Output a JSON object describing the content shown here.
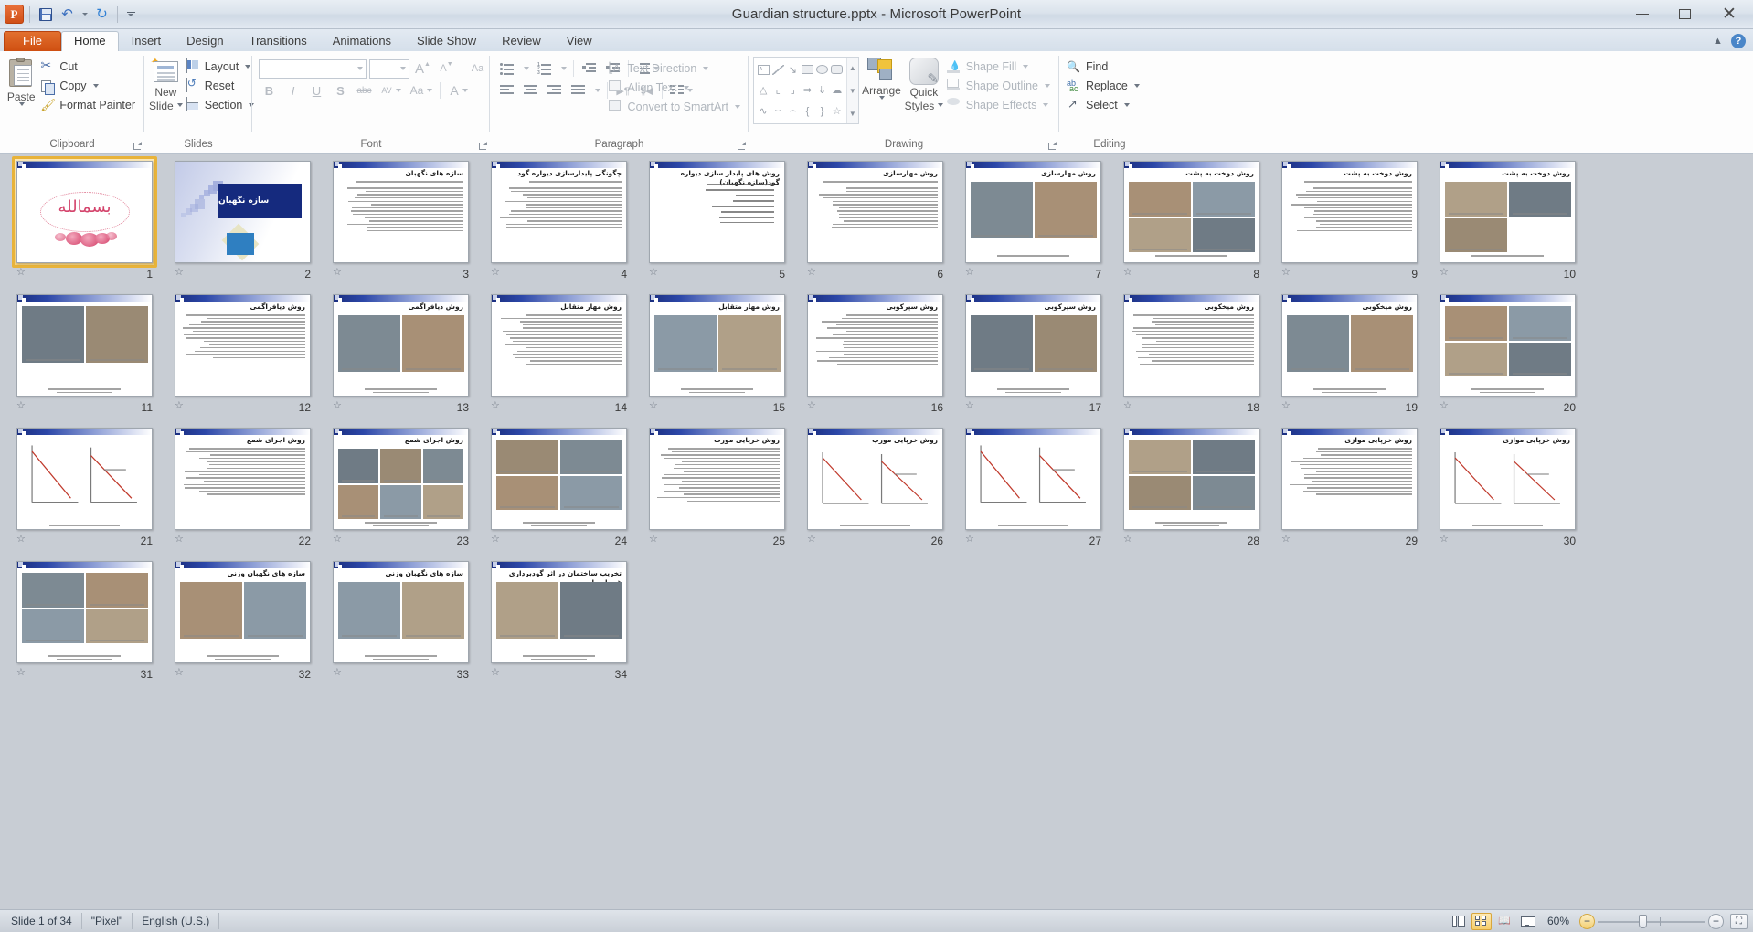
{
  "window": {
    "title": "Guardian structure.pptx  -  Microsoft PowerPoint",
    "app_logo_letter": "P",
    "quick_access": [
      {
        "name": "save",
        "icon": "save-icon",
        "label": "Save"
      },
      {
        "name": "undo",
        "icon": "undo-icon",
        "label": "Undo"
      },
      {
        "name": "redo",
        "icon": "redo-icon",
        "label": "Redo"
      },
      {
        "name": "customize",
        "icon": "chevron-down-icon",
        "label": "Customize Quick Access Toolbar"
      }
    ],
    "controls": {
      "minimize": "Minimize",
      "maximize": "Restore Down",
      "close": "Close",
      "close_glyph": "✕"
    }
  },
  "tabs": [
    {
      "label": "File",
      "state": "file"
    },
    {
      "label": "Home",
      "state": "active"
    },
    {
      "label": "Insert",
      "state": "normal"
    },
    {
      "label": "Design",
      "state": "normal"
    },
    {
      "label": "Transitions",
      "state": "normal"
    },
    {
      "label": "Animations",
      "state": "normal"
    },
    {
      "label": "Slide Show",
      "state": "normal"
    },
    {
      "label": "Review",
      "state": "normal"
    },
    {
      "label": "View",
      "state": "normal"
    }
  ],
  "tab_right": {
    "minimize_ribbon": "▲",
    "help": "?"
  },
  "ribbon": {
    "clipboard": {
      "label": "Clipboard",
      "paste": "Paste",
      "cut": "Cut",
      "copy": "Copy",
      "format_painter": "Format Painter"
    },
    "slides": {
      "label": "Slides",
      "new_slide_line1": "New",
      "new_slide_line2": "Slide",
      "layout": "Layout",
      "reset": "Reset",
      "section": "Section"
    },
    "font": {
      "label": "Font",
      "font_name_value": "",
      "font_name_placeholder": "",
      "font_size_value": "",
      "grow": "A",
      "shrink": "A",
      "clear_formatting": "Aa",
      "bold": "B",
      "italic": "I",
      "underline": "U",
      "shadow": "S",
      "strikethrough": "abc",
      "character_spacing": "AV",
      "change_case": "Aa",
      "font_color": "A"
    },
    "paragraph": {
      "label": "Paragraph",
      "text_direction": "Text Direction",
      "align_text": "Align Text",
      "convert_smartart": "Convert to SmartArt"
    },
    "drawing": {
      "label": "Drawing",
      "arrange": "Arrange",
      "quick_styles_line1": "Quick",
      "quick_styles_line2": "Styles",
      "shape_fill": "Shape Fill",
      "shape_outline": "Shape Outline",
      "shape_effects": "Shape Effects",
      "shapes": [
        "text-box",
        "line",
        "arrow",
        "rectangle",
        "oval",
        "rounded-rectangle",
        "triangle",
        "elbow-connector",
        "elbow-arrow-connector",
        "right-arrow",
        "down-arrow",
        "cloud",
        "scribble",
        "arc",
        "curve",
        "left-brace",
        "right-brace",
        "star"
      ]
    },
    "editing": {
      "label": "Editing",
      "find": "Find",
      "replace": "Replace",
      "select": "Select"
    }
  },
  "status_bar": {
    "slide_indicator": "Slide 1 of 34",
    "theme": "\"Pixel\"",
    "language": "English (U.S.)",
    "zoom_level": "60%",
    "views": [
      {
        "name": "normal-view",
        "label": "Normal",
        "active": false
      },
      {
        "name": "slide-sorter-view",
        "label": "Slide Sorter",
        "active": true
      },
      {
        "name": "reading-view",
        "label": "Reading View",
        "active": false
      },
      {
        "name": "slide-show-view",
        "label": "Slide Show",
        "active": false
      }
    ],
    "zoom_out": "−",
    "zoom_in": "+",
    "fit_window": "Fit slide to current window"
  },
  "sorter": {
    "selected_slide": 1,
    "slide_count": 34,
    "slides": [
      {
        "n": 1,
        "kind": "bismillah",
        "title": ""
      },
      {
        "n": 2,
        "kind": "title",
        "title": "سازه نگهبان"
      },
      {
        "n": 3,
        "kind": "text",
        "title": "سازه های نگهبان",
        "lines": 16
      },
      {
        "n": 4,
        "kind": "text",
        "title": "چگونگی پایدارسازی دیواره گود",
        "lines": 15
      },
      {
        "n": 5,
        "kind": "list",
        "title": "روش های پایدار سازی دیواره گود(سازه نگهبان)",
        "lines": 9
      },
      {
        "n": 6,
        "kind": "text",
        "title": "روش مهارسازی",
        "lines": 15
      },
      {
        "n": 7,
        "kind": "images-2",
        "title": "روش مهارسازی",
        "lines": 0
      },
      {
        "n": 8,
        "kind": "images-4",
        "title": "روش دوخت به پشت",
        "lines": 0
      },
      {
        "n": 9,
        "kind": "text",
        "title": "روش دوخت به پشت",
        "lines": 16
      },
      {
        "n": 10,
        "kind": "images-3",
        "title": "روش دوخت به پشت",
        "lines": 0
      },
      {
        "n": 11,
        "kind": "images-2",
        "title": "",
        "lines": 0
      },
      {
        "n": 12,
        "kind": "text",
        "title": "روش دیافراگمی",
        "lines": 14
      },
      {
        "n": 13,
        "kind": "images-2",
        "title": "روش دیافراگمی",
        "lines": 0
      },
      {
        "n": 14,
        "kind": "text",
        "title": "روش مهار متقابل",
        "lines": 16
      },
      {
        "n": 15,
        "kind": "images-2",
        "title": "روش مهار متقابل",
        "lines": 0
      },
      {
        "n": 16,
        "kind": "text",
        "title": "روش سپرکوبی",
        "lines": 16
      },
      {
        "n": 17,
        "kind": "images-2",
        "title": "روش سپرکوبی",
        "lines": 0
      },
      {
        "n": 18,
        "kind": "text",
        "title": "روش میخکوبی",
        "lines": 16
      },
      {
        "n": 19,
        "kind": "images-2",
        "title": "روش میخکوبی",
        "lines": 0
      },
      {
        "n": 20,
        "kind": "images-4",
        "title": "",
        "lines": 0
      },
      {
        "n": 21,
        "kind": "diagram",
        "title": "",
        "lines": 0
      },
      {
        "n": 22,
        "kind": "text",
        "title": "روش اجرای شمع",
        "lines": 15
      },
      {
        "n": 23,
        "kind": "images-6",
        "title": "روش اجرای شمع",
        "lines": 0
      },
      {
        "n": 24,
        "kind": "images-4",
        "title": "",
        "lines": 0
      },
      {
        "n": 25,
        "kind": "text",
        "title": "روش خرپایی مورب",
        "lines": 17
      },
      {
        "n": 26,
        "kind": "diagram",
        "title": "روش خرپایی مورب",
        "lines": 0
      },
      {
        "n": 27,
        "kind": "diagram",
        "title": "",
        "lines": 0
      },
      {
        "n": 28,
        "kind": "images-4",
        "title": "",
        "lines": 0
      },
      {
        "n": 29,
        "kind": "text",
        "title": "روش خرپایی موازی",
        "lines": 15
      },
      {
        "n": 30,
        "kind": "diagram",
        "title": "روش خرپایی موازی",
        "lines": 0
      },
      {
        "n": 31,
        "kind": "images-4",
        "title": "",
        "lines": 0
      },
      {
        "n": 32,
        "kind": "images-2",
        "title": "سازه های نگهبان وزنی",
        "lines": 0
      },
      {
        "n": 33,
        "kind": "images-2",
        "title": "سازه های نگهبان وزنی",
        "lines": 0
      },
      {
        "n": 34,
        "kind": "images-2",
        "title": "تخریب ساختمان در اثر گودبرداری غیر اصولی",
        "lines": 0
      }
    ]
  }
}
